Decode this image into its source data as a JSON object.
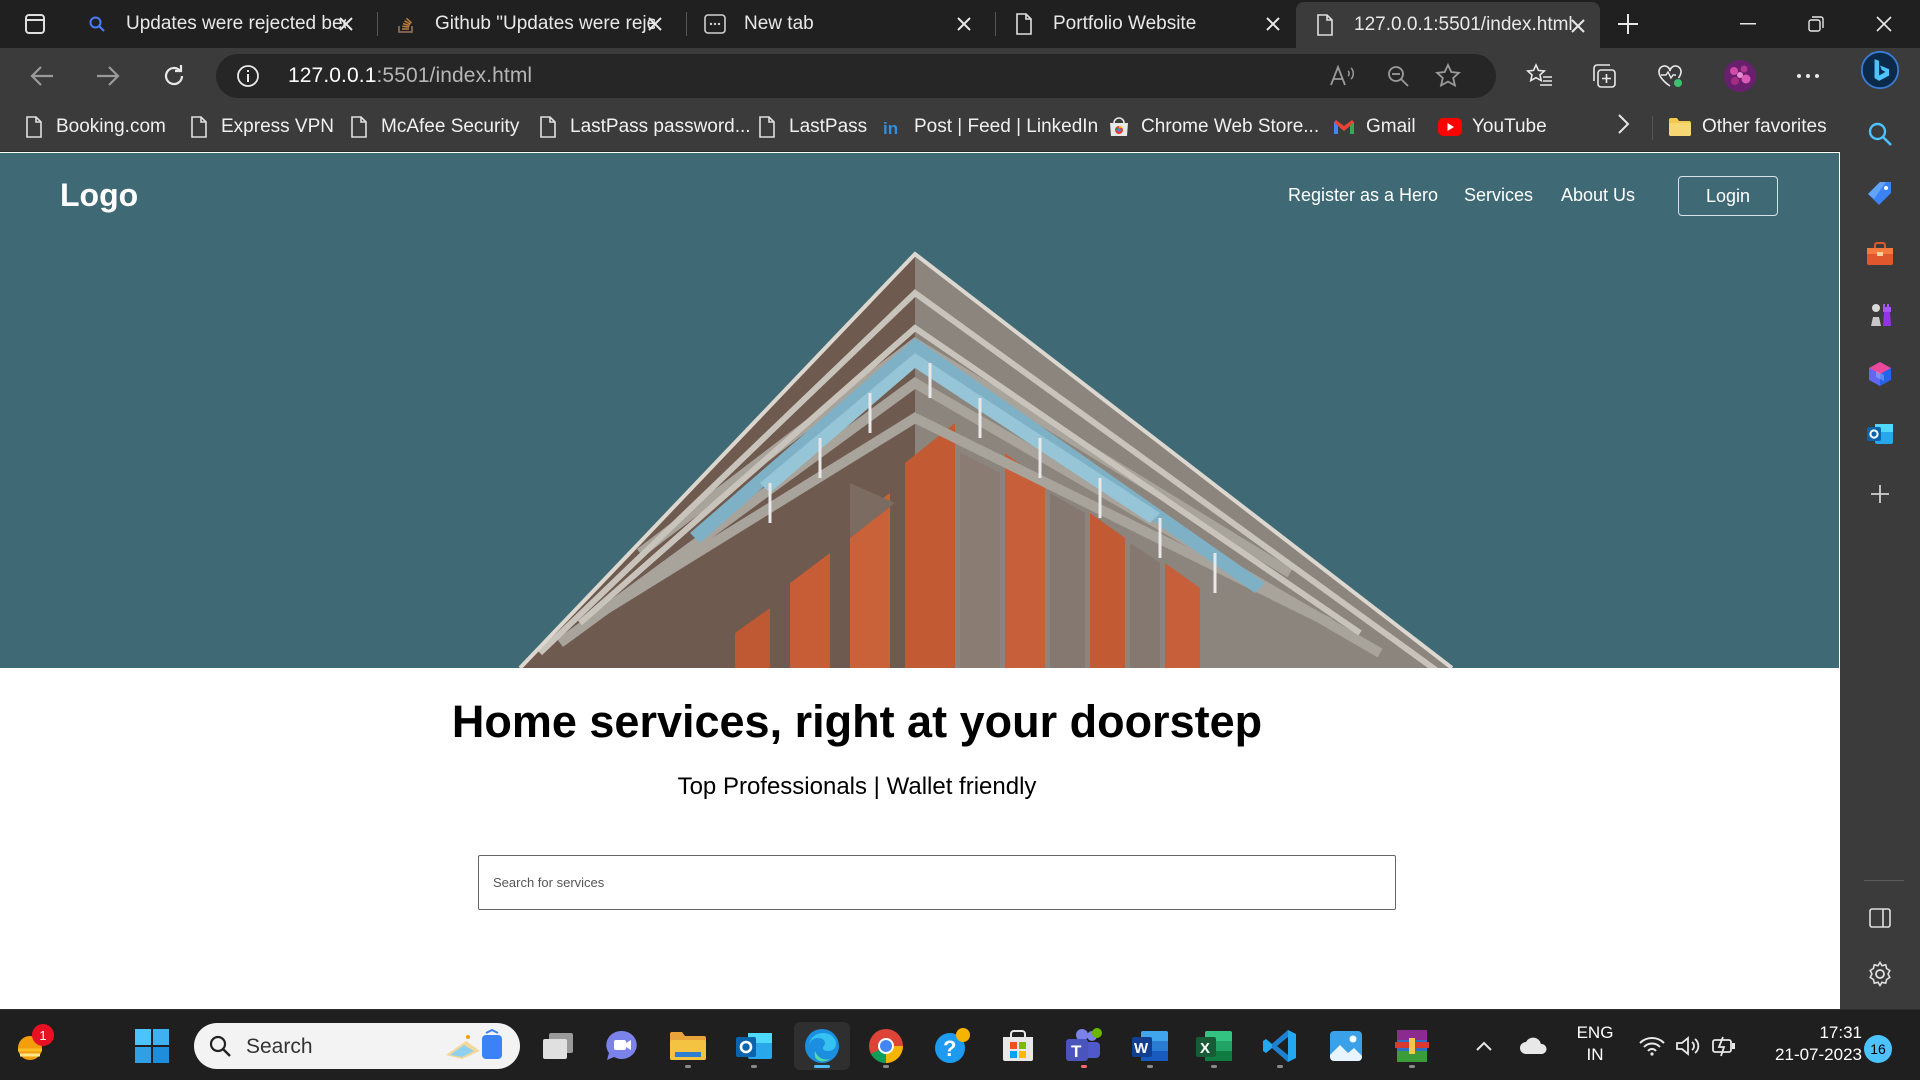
{
  "browser": {
    "tabs": [
      {
        "title": "Updates were rejected bec",
        "icon": "search-icon"
      },
      {
        "title": "Github \"Updates were reje",
        "icon": "stackoverflow-icon"
      },
      {
        "title": "New tab",
        "icon": "new-tab-page-icon"
      },
      {
        "title": "Portfolio Website",
        "icon": "page-icon"
      },
      {
        "title": "127.0.0.1:5501/index.html",
        "icon": "page-icon"
      }
    ],
    "address": {
      "host": "127.0.0.1",
      "rest": ":5501/index.html"
    },
    "favorites": [
      {
        "label": "Booking.com",
        "icon": "page-icon"
      },
      {
        "label": "Express VPN",
        "icon": "page-icon"
      },
      {
        "label": "McAfee Security",
        "icon": "page-icon"
      },
      {
        "label": "LastPass password...",
        "icon": "page-icon"
      },
      {
        "label": "LastPass",
        "icon": "page-icon"
      },
      {
        "label": "Post | Feed | LinkedIn",
        "icon": "linkedin-icon"
      },
      {
        "label": "Chrome Web Store...",
        "icon": "chrome-web-store-icon"
      },
      {
        "label": "Gmail",
        "icon": "gmail-icon"
      },
      {
        "label": "YouTube",
        "icon": "youtube-icon"
      }
    ],
    "other_favorites": "Other favorites"
  },
  "page": {
    "nav": {
      "logo": "Logo",
      "links": [
        "Register as a Hero",
        "Services",
        "About Us"
      ],
      "login": "Login"
    },
    "headline": "Home services, right at your doorstep",
    "subline": "Top Professionals | Wallet friendly",
    "search_placeholder": "Search for services"
  },
  "taskbar": {
    "search_label": "Search",
    "weather_badge": "1",
    "language": [
      "ENG",
      "IN"
    ],
    "time": "17:31",
    "date": "21-07-2023",
    "notifications": "16"
  },
  "colors": {
    "hero_bg": "#3f6a75",
    "chrome_dark": "#202020",
    "chrome_mid": "#3b3b3b",
    "edge_accent": "#4cc2ff"
  }
}
